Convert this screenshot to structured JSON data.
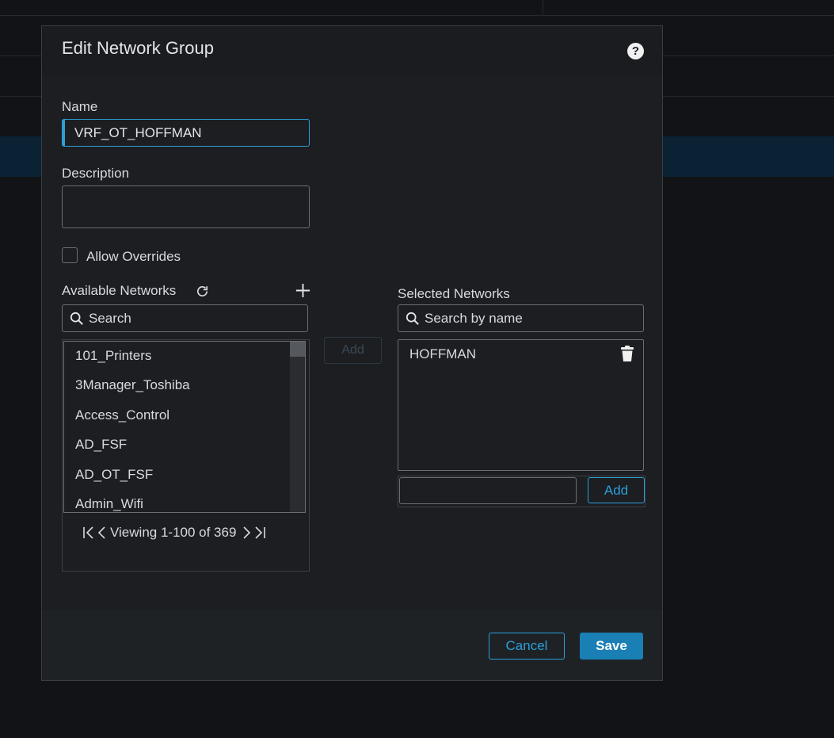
{
  "dialog": {
    "title": "Edit Network Group",
    "help_icon": "question-circle-icon",
    "help_glyph": "?"
  },
  "form": {
    "name_label": "Name",
    "name_value": "VRF_OT_HOFFMAN",
    "description_label": "Description",
    "description_value": "",
    "allow_overrides_label": "Allow Overrides",
    "allow_overrides_checked": false
  },
  "available": {
    "label": "Available Networks",
    "refresh_icon": "refresh-icon",
    "add_icon": "plus-icon",
    "search_placeholder": "Search",
    "items": [
      "101_Printers",
      "3Manager_Toshiba",
      "Access_Control",
      "AD_FSF",
      "AD_OT_FSF",
      "Admin_Wifi"
    ],
    "pager_text": "Viewing 1-100 of 369"
  },
  "middle": {
    "add_label": "Add"
  },
  "selected": {
    "label": "Selected Networks",
    "search_placeholder": "Search by name",
    "items": [
      "HOFFMAN"
    ],
    "add_input_value": "",
    "add_label": "Add"
  },
  "footer": {
    "cancel_label": "Cancel",
    "save_label": "Save"
  },
  "colors": {
    "accent": "#2b9fd8",
    "primary_button": "#1a7fb5",
    "background": "#121316",
    "dialog": "#1c1e21"
  }
}
